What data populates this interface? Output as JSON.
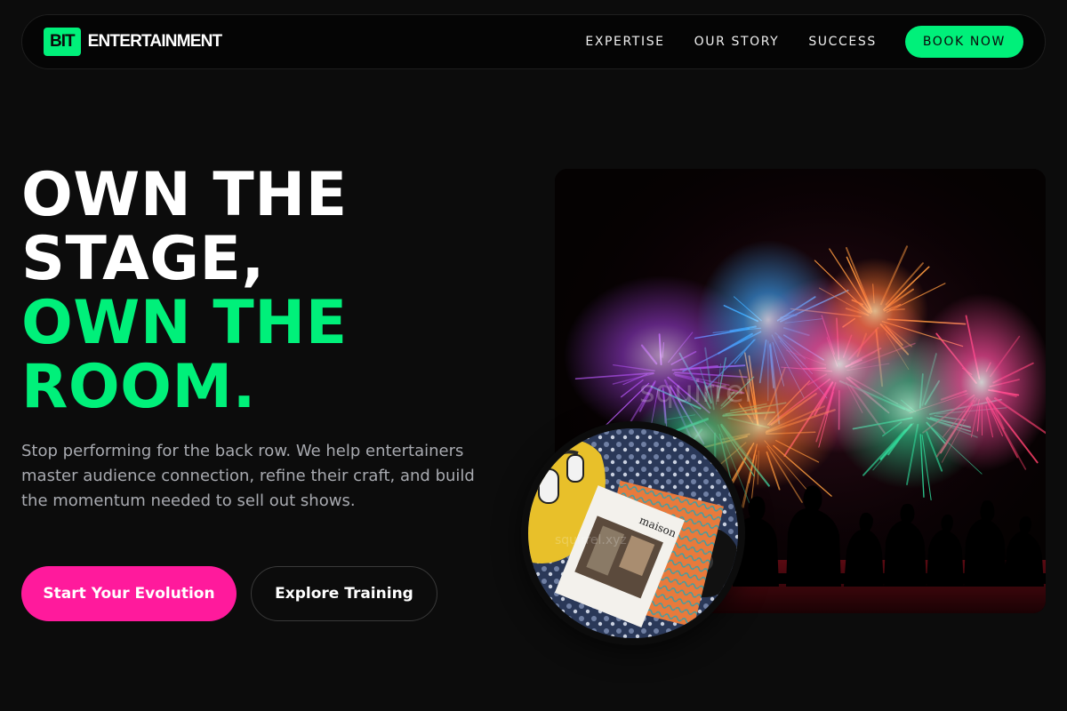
{
  "navbar": {
    "logo_badge": "BIT",
    "logo_text": "ENTERTAINMENT",
    "links": [
      "EXPERTISE",
      "OUR STORY",
      "SUCCESS"
    ],
    "book_label": "BOOK NOW"
  },
  "hero": {
    "headline_white": [
      "OWN THE",
      "STAGE,"
    ],
    "headline_green": [
      "OWN THE",
      "ROOM."
    ],
    "subtext": "Stop performing for the back row. We help entertainers master audience connection, refine their craft, and build the momentum needed to sell out shows.",
    "primary_cta": "Start Your Evolution",
    "secondary_cta": "Explore Training"
  },
  "images": {
    "main_watermark": "squirrel",
    "disc_watermark": "squirrel.xyz",
    "disc_magazine_title": "maison"
  },
  "colors": {
    "accent_green": "#00f07a",
    "accent_pink": "#ff1a9c",
    "background": "#0c0c0c"
  }
}
